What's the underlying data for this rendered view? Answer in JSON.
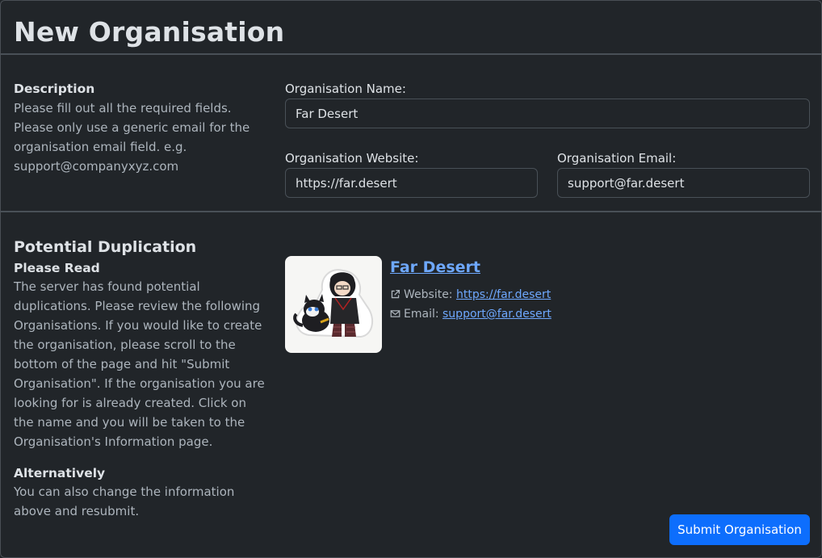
{
  "page": {
    "title": "New Organisation"
  },
  "description": {
    "heading": "Description",
    "text": "Please fill out all the required fields. Please only use a generic email for the organisation email field. e.g. support@companyxyz.com"
  },
  "form": {
    "name_label": "Organisation Name:",
    "name_value": "Far Desert",
    "website_label": "Organisation Website:",
    "website_value": "https://far.desert",
    "email_label": "Organisation Email:",
    "email_value": "support@far.desert"
  },
  "duplication": {
    "heading": "Potential Duplication",
    "subheading": "Please Read",
    "text": "The server has found potential duplications. Please review the following Organisations. If you would like to create the organisation, please scroll to the bottom of the page and hit \"Submit Organisation\". If the organisation you are looking for is already created. Click on the name and you will be taken to the Organisation's Information page.",
    "alt_heading": "Alternatively",
    "alt_text": "You can also change the information above and resubmit."
  },
  "matches": [
    {
      "name": "Far Desert",
      "website_label": "Website:",
      "website": "https://far.desert",
      "email_label": "Email:",
      "email": "support@far.desert",
      "icons": {
        "website": "external-link-icon",
        "email": "envelope-icon"
      }
    }
  ],
  "actions": {
    "submit_label": "Submit Organisation"
  },
  "colors": {
    "background": "#212529",
    "link": "#6ea8fe",
    "primary": "#0d6efd",
    "border": "#495057"
  }
}
